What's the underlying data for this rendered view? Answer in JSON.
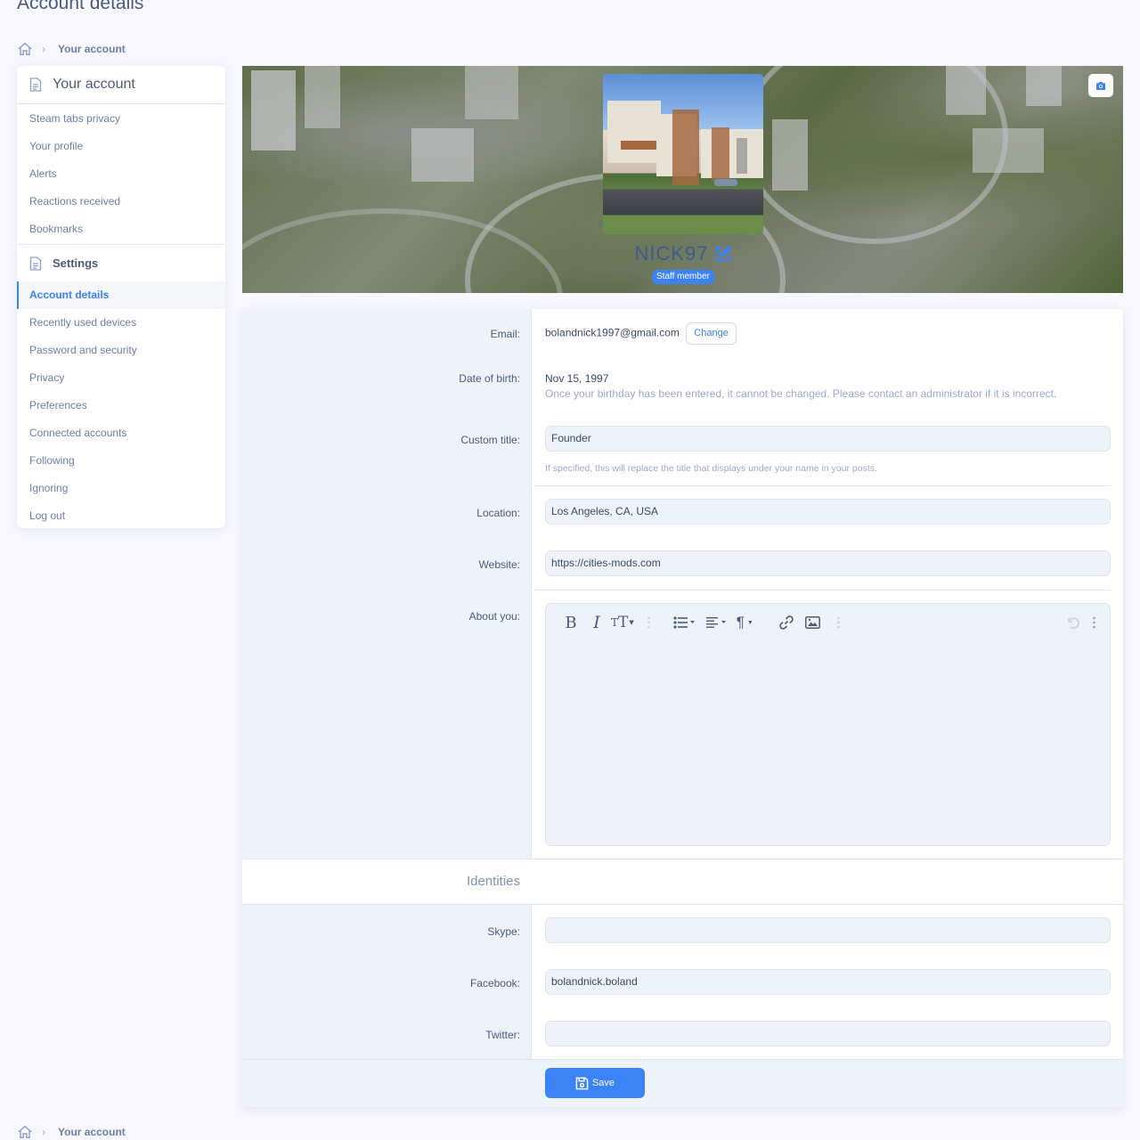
{
  "page": {
    "title": "Account details"
  },
  "breadcrumb": {
    "items": [
      "Your account"
    ],
    "home_icon": "home-icon"
  },
  "sidebar": {
    "section1": {
      "title": "Your account",
      "icon": "document-icon",
      "items": [
        {
          "label": "Steam tabs privacy"
        },
        {
          "label": "Your profile"
        },
        {
          "label": "Alerts"
        },
        {
          "label": "Reactions received"
        },
        {
          "label": "Bookmarks"
        }
      ]
    },
    "section2": {
      "title": "Settings",
      "icon": "document-icon",
      "items": [
        {
          "label": "Account details",
          "active": true
        },
        {
          "label": "Recently used devices"
        },
        {
          "label": "Password and security"
        },
        {
          "label": "Privacy"
        },
        {
          "label": "Preferences"
        },
        {
          "label": "Connected accounts"
        },
        {
          "label": "Following"
        },
        {
          "label": "Ignoring"
        },
        {
          "label": "Log out"
        }
      ]
    }
  },
  "profile": {
    "username": "NICK97",
    "badge": "Staff member",
    "edit_icon": "edit-icon",
    "banner_button_icon": "camera-icon"
  },
  "form": {
    "email": {
      "label": "Email:",
      "value": "bolandnick1997@gmail.com",
      "button": "Change"
    },
    "dob": {
      "label": "Date of birth:",
      "value": "Nov 15, 1997",
      "hint": "Once your birthday has been entered, it cannot be changed. Please contact an administrator if it is incorrect."
    },
    "custom_title": {
      "label": "Custom title:",
      "value": "Founder",
      "hint": "If specified, this will replace the title that displays under your name in your posts."
    },
    "location": {
      "label": "Location:",
      "value": "Los Angeles, CA, USA"
    },
    "website": {
      "label": "Website:",
      "value": "https://cities-mods.com"
    },
    "about": {
      "label": "About you:",
      "value": "",
      "toolbar": [
        "bold",
        "italic",
        "text-size",
        "more",
        "list",
        "align",
        "paragraph",
        "link",
        "image",
        "more",
        "undo",
        "more"
      ]
    },
    "identities": {
      "heading": "Identities",
      "skype": {
        "label": "Skype:",
        "value": ""
      },
      "facebook": {
        "label": "Facebook:",
        "value": "bolandnick.boland"
      },
      "twitter": {
        "label": "Twitter:",
        "value": ""
      }
    },
    "save_label": "Save"
  },
  "colors": {
    "accent": "#3b82f6",
    "background": "#f6f8fd",
    "label_column": "#eef2f9",
    "muted_text": "#6b7fa3"
  }
}
